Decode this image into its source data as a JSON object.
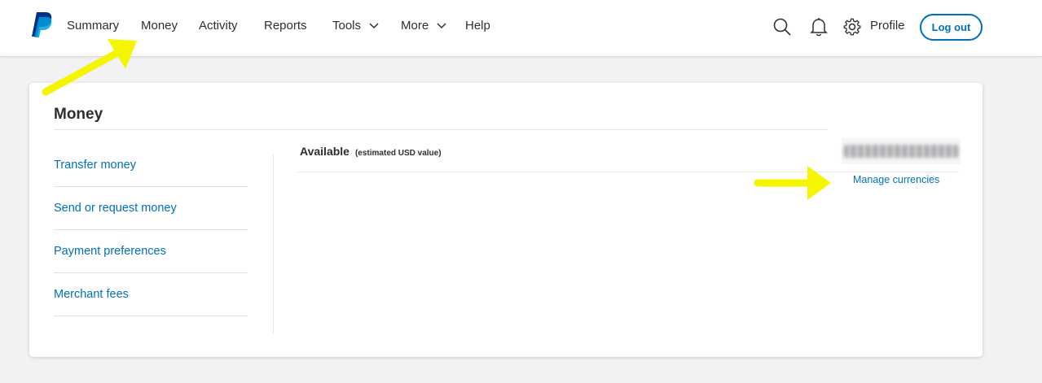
{
  "nav": {
    "items": [
      {
        "label": "Summary"
      },
      {
        "label": "Money"
      },
      {
        "label": "Activity"
      },
      {
        "label": "Reports"
      },
      {
        "label": "Tools"
      },
      {
        "label": "More"
      },
      {
        "label": "Help"
      }
    ],
    "profile_label": "Profile",
    "logout_label": "Log out",
    "icons": [
      "paypal-logo",
      "search-icon",
      "bell-icon",
      "gear-icon"
    ]
  },
  "card": {
    "title": "Money",
    "sidebar": [
      {
        "label": "Transfer money"
      },
      {
        "label": "Send or request money"
      },
      {
        "label": "Payment preferences"
      },
      {
        "label": "Merchant fees"
      }
    ],
    "available_label": "Available",
    "available_sub": "(estimated USD value)",
    "manage_label": "Manage currencies"
  },
  "colors": {
    "brand_blue": "#0070ba",
    "logo_dark": "#003087",
    "logo_light": "#009cde",
    "annotation_arrow": "#f5f500",
    "page_bg": "#f2f2f5"
  }
}
